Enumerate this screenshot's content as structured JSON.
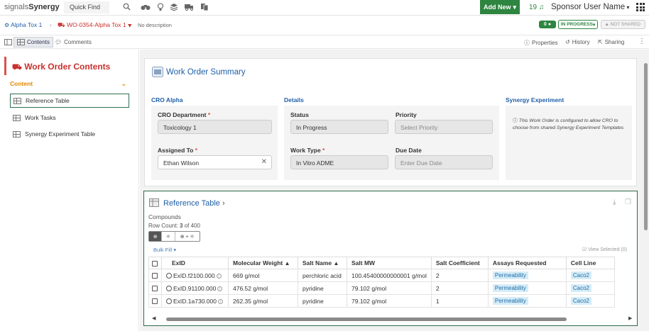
{
  "topbar": {
    "logo_prefix": "signals",
    "logo_brand": "Synergy",
    "quick_find": "Quick Find",
    "add_new": "Add New",
    "notifications": "19",
    "user": "Sponsor User Name"
  },
  "breadcrumb": {
    "item1": "Alpha Tox 1",
    "item2": "WO-0354-Alpha Tox 1",
    "desc": "No description"
  },
  "badges": {
    "count": "0",
    "status": "IN PROGRESS",
    "sharing": "NOT SHARED"
  },
  "tabs": {
    "contents": "Contents",
    "comments": "Comments",
    "properties": "Properties",
    "history": "History",
    "sharing": "Sharing"
  },
  "sidebar": {
    "title": "Work Order Contents",
    "section": "Content",
    "items": [
      {
        "label": "Reference Table"
      },
      {
        "label": "Work Tasks"
      },
      {
        "label": "Synergy Experiment Table"
      }
    ]
  },
  "summary": {
    "title": "Work Order Summary",
    "cro": {
      "heading": "CRO Alpha",
      "dept_label": "CRO Department",
      "dept_value": "Toxicology 1",
      "assigned_label": "Assigned To",
      "assigned_value": "Ethan Wilson"
    },
    "details": {
      "heading": "Details",
      "status_label": "Status",
      "status_value": "In Progress",
      "priority_label": "Priority",
      "priority_placeholder": "Select Priority",
      "type_label": "Work Type",
      "type_value": "In Vitro ADME",
      "due_label": "Due Date",
      "due_placeholder": "Enter Due Date"
    },
    "experiment": {
      "heading": "Synergy Experiment",
      "info": "This Work Order is configured to allow CRO to choose from shared Synergy Experiment Templates"
    }
  },
  "reference": {
    "title": "Reference Table",
    "subtitle": "Compounds",
    "row_count_prefix": "Row Count: ",
    "row_count_shown": "3",
    "row_count_suffix": " of 400",
    "bulk_fill": "Bulk Fill",
    "view_selected": "View Selected (0)",
    "columns": [
      "ExID",
      "Molecular Weight",
      "Salt Name",
      "Salt MW",
      "Salt Coefficient",
      "Assays Requested",
      "Cell Line"
    ],
    "rows": [
      {
        "exid": "ExID.f2100.000",
        "mw": "669 g/mol",
        "salt": "perchloric acid",
        "salt_mw": "100.45400000000001 g/mol",
        "coef": "2",
        "assay": "Permeability",
        "cell": "Caco2"
      },
      {
        "exid": "ExID.91100.000",
        "mw": "476.52 g/mol",
        "salt": "pyridine",
        "salt_mw": "79.102 g/mol",
        "coef": "2",
        "assay": "Permeability",
        "cell": "Caco2"
      },
      {
        "exid": "ExID.1a730.000",
        "mw": "262.35 g/mol",
        "salt": "pyridine",
        "salt_mw": "79.102 g/mol",
        "coef": "1",
        "assay": "Permeability",
        "cell": "Caco2"
      }
    ]
  },
  "colors": {
    "green": "#2e8540",
    "blue": "#1f5fa8",
    "red": "#c9302c",
    "orange": "#e08a00"
  }
}
